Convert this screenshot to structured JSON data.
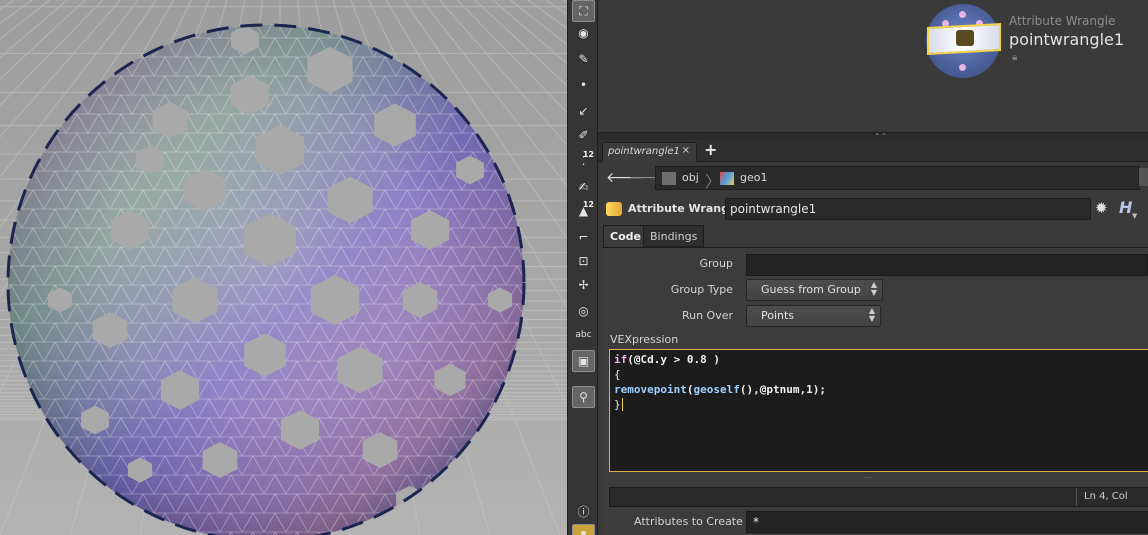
{
  "network": {
    "node_type": "Attribute Wrangle",
    "node_name": "pointwrangle1"
  },
  "pane": {
    "tab_label": "pointwrangle1",
    "tab_close": "×",
    "add_tab": "+"
  },
  "path": {
    "crumbs": [
      "obj",
      "geo1"
    ]
  },
  "param_header": {
    "type_label": "Attribute Wrangle",
    "node_name": "pointwrangle1"
  },
  "param_tabs": [
    "Code",
    "Bindings"
  ],
  "params": {
    "group_label": "Group",
    "group_value": "",
    "group_type_label": "Group Type",
    "group_type_value": "Guess from Group",
    "run_over_label": "Run Over",
    "run_over_value": "Points",
    "vex_label": "VEXpression",
    "code_lines": [
      "if(@Cd.y > 0.8 )",
      "{",
      "removepoint(geoself(),@ptnum,1);",
      "}"
    ],
    "status": "Ln 4, Col",
    "attrs_label": "Attributes to Create",
    "attrs_value": "*"
  },
  "toolbar": {
    "tools": [
      "select-icon",
      "view-icon",
      "point-icon",
      "edge-icon",
      "paint-icon",
      "num-12-icon",
      "brush-icon",
      "num-12b-icon",
      "frame-icon",
      "snap-icon",
      "handle-icon",
      "ghost-icon",
      "abc",
      "display-icon",
      "pin-icon",
      "info-icon",
      "pause-icon"
    ]
  },
  "colors": {
    "accent_yellow": "#f3d54a",
    "keyword": "#f2b0ef",
    "function": "#9fd0ff"
  }
}
